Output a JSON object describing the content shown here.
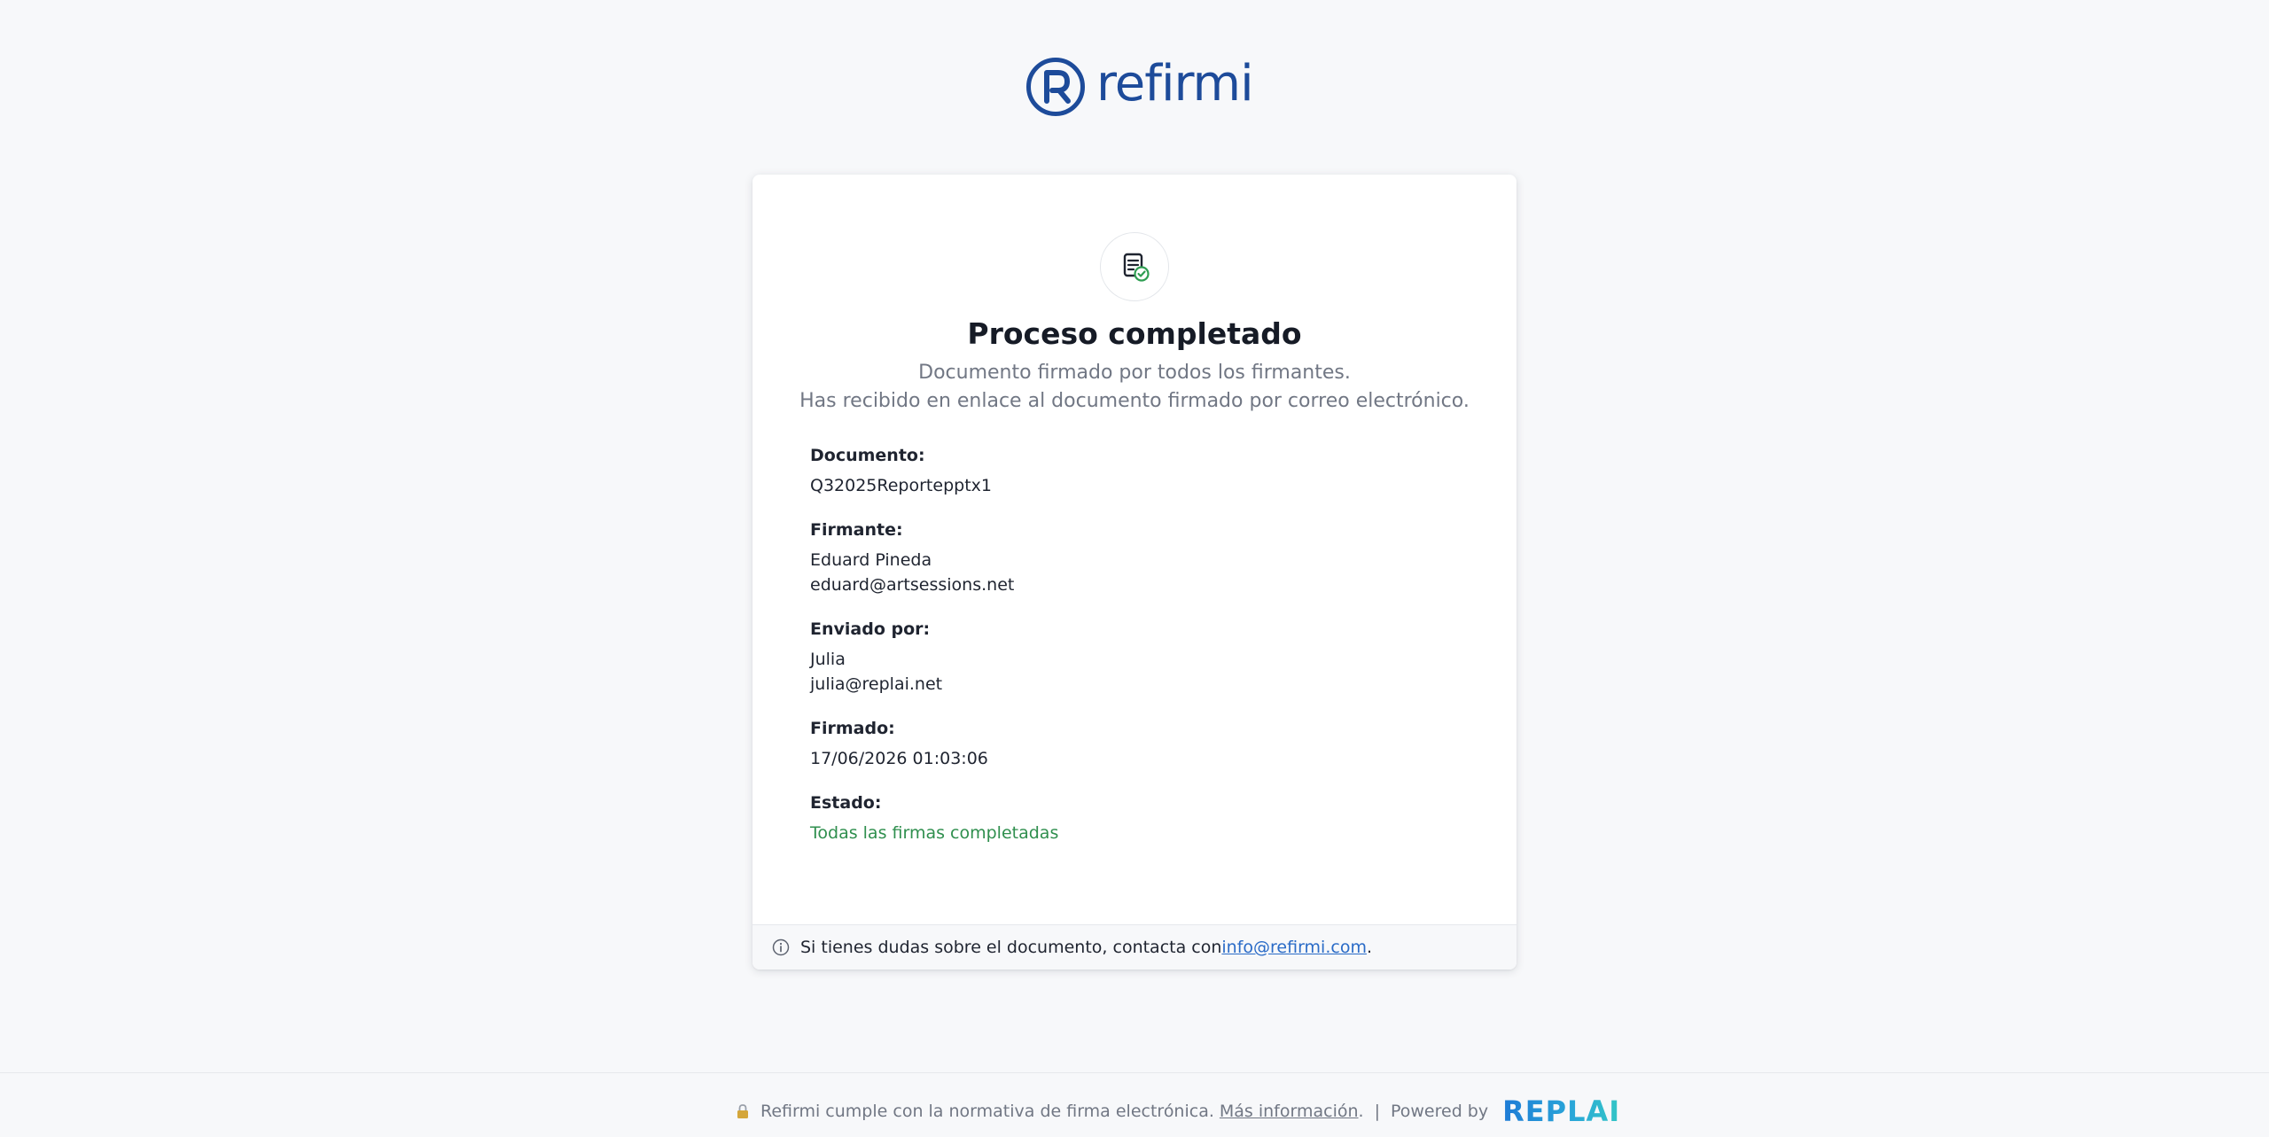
{
  "brand": {
    "logo_text": "refirmi",
    "logo_color": "#1d4b9a"
  },
  "card": {
    "icon": "document-check-icon",
    "title": "Proceso completado",
    "subtitle_line1": "Documento firmado por todos los firmantes.",
    "subtitle_line2": "Has recibido en enlace al documento firmado por correo electrónico.",
    "fields": {
      "document": {
        "label": "Documento:",
        "value": "Q32025Reportepptx1"
      },
      "signer": {
        "label": "Firmante:",
        "name": "Eduard Pineda",
        "email": "eduard@artsessions.net"
      },
      "sent_by": {
        "label": "Enviado por:",
        "name": "Julia",
        "email": "julia@replai.net"
      },
      "signed": {
        "label": "Firmado:",
        "value": "17/06/2026 01:03:06"
      },
      "status": {
        "label": "Estado:",
        "value": "Todas las firmas completadas",
        "color": "#2f8f4e"
      }
    },
    "footer": {
      "icon": "info-icon",
      "text": "Si tienes dudas sobre el documento, contacta con ",
      "email_link": "info@refirmi.com",
      "suffix": "."
    }
  },
  "bottom_bar": {
    "icon": "lock-icon",
    "compliance_text": "Refirmi cumple con la normativa de firma electrónica.",
    "more_info_link": "Más información",
    "after_link": ".",
    "separator": "|",
    "powered_by": "Powered by",
    "partner_logo": "REPLAI"
  },
  "colors": {
    "background": "#f7f8fa",
    "card": "#ffffff",
    "link": "#2a6bc7",
    "success": "#2f8f4e"
  }
}
